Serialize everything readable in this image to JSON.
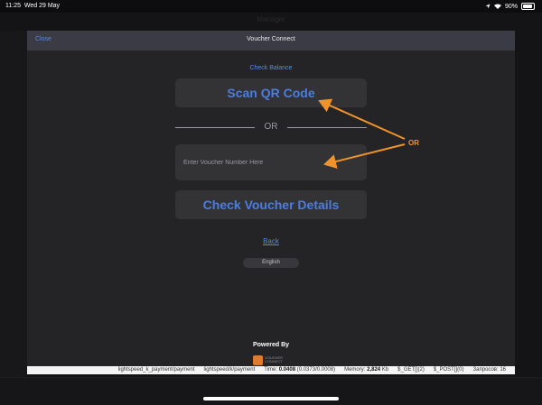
{
  "status_bar": {
    "time": "11:25",
    "date": "Wed 29 May",
    "battery": "90%"
  },
  "background": {
    "title": "Manager"
  },
  "modal": {
    "close_label": "Close",
    "title": "Voucher Connect",
    "check_balance": "Check Balance",
    "scan_qr_label": "Scan QR Code",
    "or_divider": "OR",
    "voucher_placeholder": "Enter Voucher Number Here",
    "voucher_value": "",
    "check_details_label": "Check Voucher Details",
    "back_label": "Back",
    "language": "English",
    "powered_by": "Powered By",
    "logo_text_1": "VOUCHER",
    "logo_text_2": "CONNECT"
  },
  "debug_bar": {
    "route": "lightspeed_k_payment/payment",
    "path": "lightspeed/k/payment",
    "time_label": "Time:",
    "time_value": "0.0408",
    "time_detail": "(0.0373/0.0008)",
    "memory_label": "Memory:",
    "memory_value": "2,824",
    "memory_unit": "Kb",
    "get": "$_GET[](2)",
    "post": "$_POST[](0)",
    "queries": "Запросов: 16"
  },
  "annotation": {
    "label": "OR",
    "color": "#f0932b"
  },
  "colors": {
    "link_blue": "#5b8bd8",
    "button_text": "#4a7de2",
    "accent_orange": "#f0932b"
  },
  "icons": [
    "wifi-icon",
    "location-icon",
    "battery-icon"
  ]
}
